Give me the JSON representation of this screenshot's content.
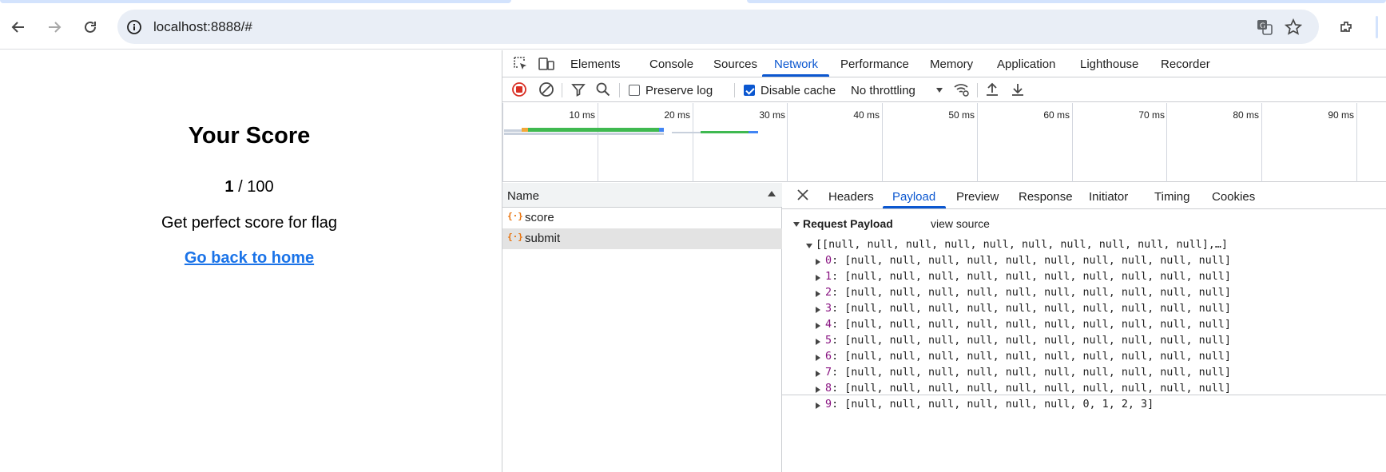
{
  "browser": {
    "url": "localhost:8888/#",
    "icons": [
      "back-arrow-icon",
      "forward-arrow-icon",
      "reload-icon",
      "site-info-icon",
      "translate-icon",
      "bookmark-star-icon",
      "extensions-icon"
    ]
  },
  "page": {
    "title": "Your Score",
    "score_value": "1",
    "score_rest": " / 100",
    "flag_text": "Get perfect score for flag",
    "home_link": "Go back to home"
  },
  "devtools": {
    "tabs": [
      "Elements",
      "Console",
      "Sources",
      "Network",
      "Performance",
      "Memory",
      "Application",
      "Lighthouse",
      "Recorder"
    ],
    "active_tab": "Network",
    "toolbar": {
      "preserve_log_label": "Preserve log",
      "preserve_log_checked": false,
      "disable_cache_label": "Disable cache",
      "disable_cache_checked": true,
      "throttling": "No throttling"
    },
    "overview": {
      "ticks": [
        "10 ms",
        "20 ms",
        "30 ms",
        "40 ms",
        "50 ms",
        "60 ms",
        "70 ms",
        "80 ms",
        "90 ms"
      ]
    },
    "requests": {
      "header": "Name",
      "rows": [
        {
          "name": "score",
          "selected": false
        },
        {
          "name": "submit",
          "selected": true
        }
      ]
    },
    "details": {
      "tabs": [
        "Headers",
        "Payload",
        "Preview",
        "Response",
        "Initiator",
        "Timing",
        "Cookies"
      ],
      "active_tab": "Payload",
      "section_title": "Request Payload",
      "view_source": "view source",
      "root_summary": "[[null, null, null, null, null, null, null, null, null, null],…]",
      "items": [
        {
          "key": "0",
          "value": "[null, null, null, null, null, null, null, null, null, null]"
        },
        {
          "key": "1",
          "value": "[null, null, null, null, null, null, null, null, null, null]"
        },
        {
          "key": "2",
          "value": "[null, null, null, null, null, null, null, null, null, null]"
        },
        {
          "key": "3",
          "value": "[null, null, null, null, null, null, null, null, null, null]"
        },
        {
          "key": "4",
          "value": "[null, null, null, null, null, null, null, null, null, null]"
        },
        {
          "key": "5",
          "value": "[null, null, null, null, null, null, null, null, null, null]"
        },
        {
          "key": "6",
          "value": "[null, null, null, null, null, null, null, null, null, null]"
        },
        {
          "key": "7",
          "value": "[null, null, null, null, null, null, null, null, null, null]"
        },
        {
          "key": "8",
          "value": "[null, null, null, null, null, null, null, null, null, null]"
        },
        {
          "key": "9",
          "value": "[null, null, null, null, null, null, 0, 1, 2, 3]"
        }
      ]
    }
  },
  "colors": {
    "accent": "#0b57d0",
    "link": "#1a73e8",
    "record_red": "#d93025",
    "key_purple": "#881280"
  }
}
